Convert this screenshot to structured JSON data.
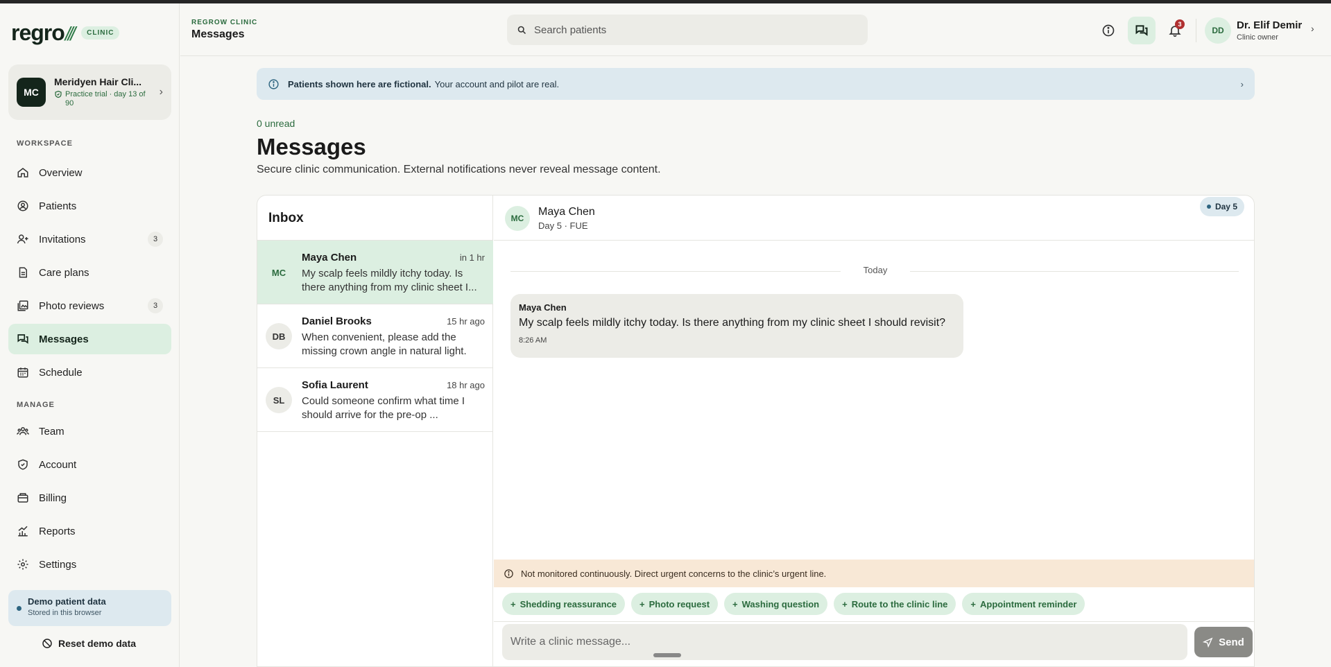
{
  "brand": {
    "logo": "regro",
    "logo_mark": "///",
    "tag": "CLINIC"
  },
  "org": {
    "initials": "MC",
    "name": "Meridyen Hair Cli...",
    "trial": "Practice trial · day 13 of 90"
  },
  "sidebar": {
    "workspace_label": "WORKSPACE",
    "manage_label": "MANAGE",
    "workspace_items": [
      {
        "label": "Overview",
        "icon": "home-icon"
      },
      {
        "label": "Patients",
        "icon": "user-circle-icon"
      },
      {
        "label": "Invitations",
        "icon": "user-plus-icon",
        "badge": "3"
      },
      {
        "label": "Care plans",
        "icon": "document-icon"
      },
      {
        "label": "Photo reviews",
        "icon": "images-icon",
        "badge": "3"
      },
      {
        "label": "Messages",
        "icon": "chat-icon",
        "active": true
      },
      {
        "label": "Schedule",
        "icon": "calendar-icon"
      }
    ],
    "manage_items": [
      {
        "label": "Team",
        "icon": "team-icon"
      },
      {
        "label": "Account",
        "icon": "shield-icon"
      },
      {
        "label": "Billing",
        "icon": "wallet-icon"
      },
      {
        "label": "Reports",
        "icon": "chart-icon"
      },
      {
        "label": "Settings",
        "icon": "gear-icon"
      }
    ],
    "demo": {
      "title": "Demo patient data",
      "sub": "Stored in this browser"
    },
    "reset_label": "Reset demo data"
  },
  "header": {
    "crumb": "REGROW CLINIC",
    "title": "Messages",
    "search_placeholder": "Search patients",
    "notif_count": "3",
    "user": {
      "initials": "DD",
      "name": "Dr. Elif Demir",
      "role": "Clinic owner"
    }
  },
  "banner": {
    "bold": "Patients shown here are fictional.",
    "text": "Your account and pilot are real."
  },
  "main": {
    "unread": "0 unread",
    "title": "Messages",
    "subtitle": "Secure clinic communication. External notifications never reveal message content."
  },
  "inbox": {
    "title": "Inbox",
    "conversations": [
      {
        "initials": "MC",
        "name": "Maya Chen",
        "time": "in 1 hr",
        "preview": "My scalp feels mildly itchy today. Is there anything from my clinic sheet I...",
        "active": true
      },
      {
        "initials": "DB",
        "name": "Daniel Brooks",
        "time": "15 hr ago",
        "preview": "When convenient, please add the missing crown angle in natural light."
      },
      {
        "initials": "SL",
        "name": "Sofia Laurent",
        "time": "18 hr ago",
        "preview": "Could someone confirm what time I should arrive for the pre-op ..."
      }
    ]
  },
  "thread": {
    "initials": "MC",
    "name": "Maya Chen",
    "sub": "Day 5 · FUE",
    "day_pill": "Day 5",
    "date_label": "Today",
    "message": {
      "sender": "Maya Chen",
      "text": "My scalp feels mildly itchy today. Is there anything from my clinic sheet I should revisit?",
      "time": "8:26 AM"
    },
    "warning": "Not monitored continuously. Direct urgent concerns to the clinic’s urgent line.",
    "chips": [
      "Shedding reassurance",
      "Photo request",
      "Washing question",
      "Route to the clinic line",
      "Appointment reminder"
    ],
    "compose_placeholder": "Write a clinic message...",
    "send_label": "Send"
  }
}
